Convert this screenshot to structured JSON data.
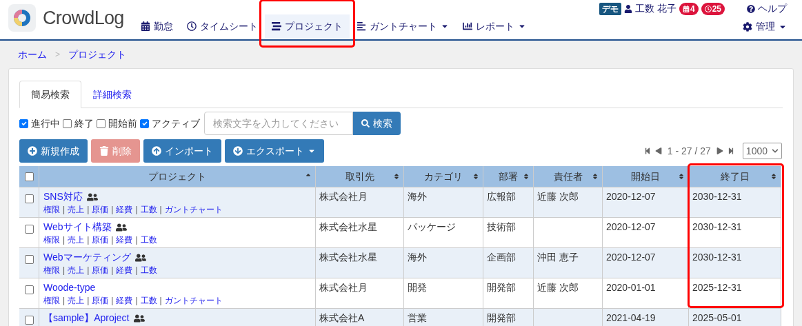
{
  "header": {
    "logo": "CrowdLog",
    "demo_badge": "デモ",
    "user": "工数 花子",
    "badges": [
      {
        "kind": "calendar",
        "count": "4"
      },
      {
        "kind": "clock",
        "count": "25"
      }
    ],
    "help": "ヘルプ",
    "nav": [
      {
        "kind": "calendar",
        "label": "勤怠",
        "selected": false,
        "dropdown": false,
        "highlighted": false
      },
      {
        "kind": "clock",
        "label": "タイムシート",
        "selected": false,
        "dropdown": false,
        "highlighted": false
      },
      {
        "kind": "project",
        "label": "プロジェクト",
        "selected": true,
        "dropdown": false,
        "highlighted": true
      },
      {
        "kind": "gantt",
        "label": "ガントチャート",
        "selected": false,
        "dropdown": true,
        "highlighted": false
      },
      {
        "kind": "chart",
        "label": "レポート",
        "selected": false,
        "dropdown": true,
        "highlighted": false
      }
    ],
    "admin": {
      "label": "管理",
      "dropdown": true
    }
  },
  "breadcrumb": {
    "items": [
      "ホーム",
      "プロジェクト"
    ],
    "separator": ">"
  },
  "tabs": [
    {
      "label": "簡易検索",
      "selected": true
    },
    {
      "label": "詳細検索",
      "selected": false
    }
  ],
  "filters": [
    {
      "label": "進行中",
      "checked": true
    },
    {
      "label": "終了",
      "checked": false
    },
    {
      "label": "開始前",
      "checked": false
    },
    {
      "label": "アクティブ",
      "checked": true
    }
  ],
  "search": {
    "placeholder": "検索文字を入力してください",
    "button": "検索"
  },
  "actions": [
    {
      "kind": "create",
      "label": "新規作成",
      "disabled": false,
      "dropdown": false
    },
    {
      "kind": "delete",
      "label": "削除",
      "disabled": true,
      "dropdown": false
    },
    {
      "kind": "import",
      "label": "インポート",
      "disabled": false,
      "dropdown": false
    },
    {
      "kind": "export",
      "label": "エクスポート",
      "disabled": false,
      "dropdown": true
    }
  ],
  "pagination": {
    "range": "1 - 27 / 27",
    "page_size": "1000"
  },
  "table": {
    "select_all": false,
    "project_column": {
      "label": "プロジェクト",
      "sorted": true
    },
    "columns": [
      {
        "label": "取引先",
        "sorted": false,
        "highlighted": false
      },
      {
        "label": "カテゴリ",
        "sorted": false,
        "highlighted": false
      },
      {
        "label": "部署",
        "sorted": false,
        "highlighted": false
      },
      {
        "label": "責任者",
        "sorted": false,
        "highlighted": false
      },
      {
        "label": "開始日",
        "sorted": false,
        "highlighted": false
      },
      {
        "label": "終了日",
        "sorted": false,
        "highlighted": true
      }
    ],
    "rows": [
      {
        "selected": false,
        "name": "SNS対応",
        "members": true,
        "links": [
          "権限",
          "|",
          "売上",
          "|",
          "原価",
          "|",
          "経費",
          "|",
          "工数",
          "|",
          "ガントチャート"
        ],
        "cells": [
          "株式会社月",
          "海外",
          "広報部",
          "近藤 次郎",
          "2020-12-07",
          "2030-12-31"
        ]
      },
      {
        "selected": false,
        "name": "Webサイト構築",
        "members": true,
        "links": [
          "権限",
          "|",
          "売上",
          "|",
          "原価",
          "|",
          "経費",
          "|",
          "工数"
        ],
        "cells": [
          "株式会社水星",
          "パッケージ",
          "技術部",
          "",
          "2020-12-07",
          "2030-12-31"
        ]
      },
      {
        "selected": false,
        "name": "Webマーケティング",
        "members": true,
        "links": [
          "権限",
          "|",
          "売上",
          "|",
          "原価",
          "|",
          "経費",
          "|",
          "工数"
        ],
        "cells": [
          "株式会社水星",
          "海外",
          "企画部",
          "沖田 恵子",
          "2020-12-07",
          "2030-12-31"
        ]
      },
      {
        "selected": false,
        "name": "Woode-type",
        "members": false,
        "links": [
          "権限",
          "|",
          "売上",
          "|",
          "原価",
          "|",
          "経費",
          "|",
          "工数",
          "|",
          "ガントチャート"
        ],
        "cells": [
          "株式会社月",
          "開発",
          "開発部",
          "近藤 次郎",
          "2020-01-01",
          "2025-12-31"
        ]
      },
      {
        "selected": false,
        "name": "【sample】Aproject",
        "members": true,
        "links": [],
        "cells": [
          "株式会社A",
          "営業",
          "開発部",
          "",
          "2021-04-19",
          "2025-05-01"
        ]
      }
    ]
  }
}
